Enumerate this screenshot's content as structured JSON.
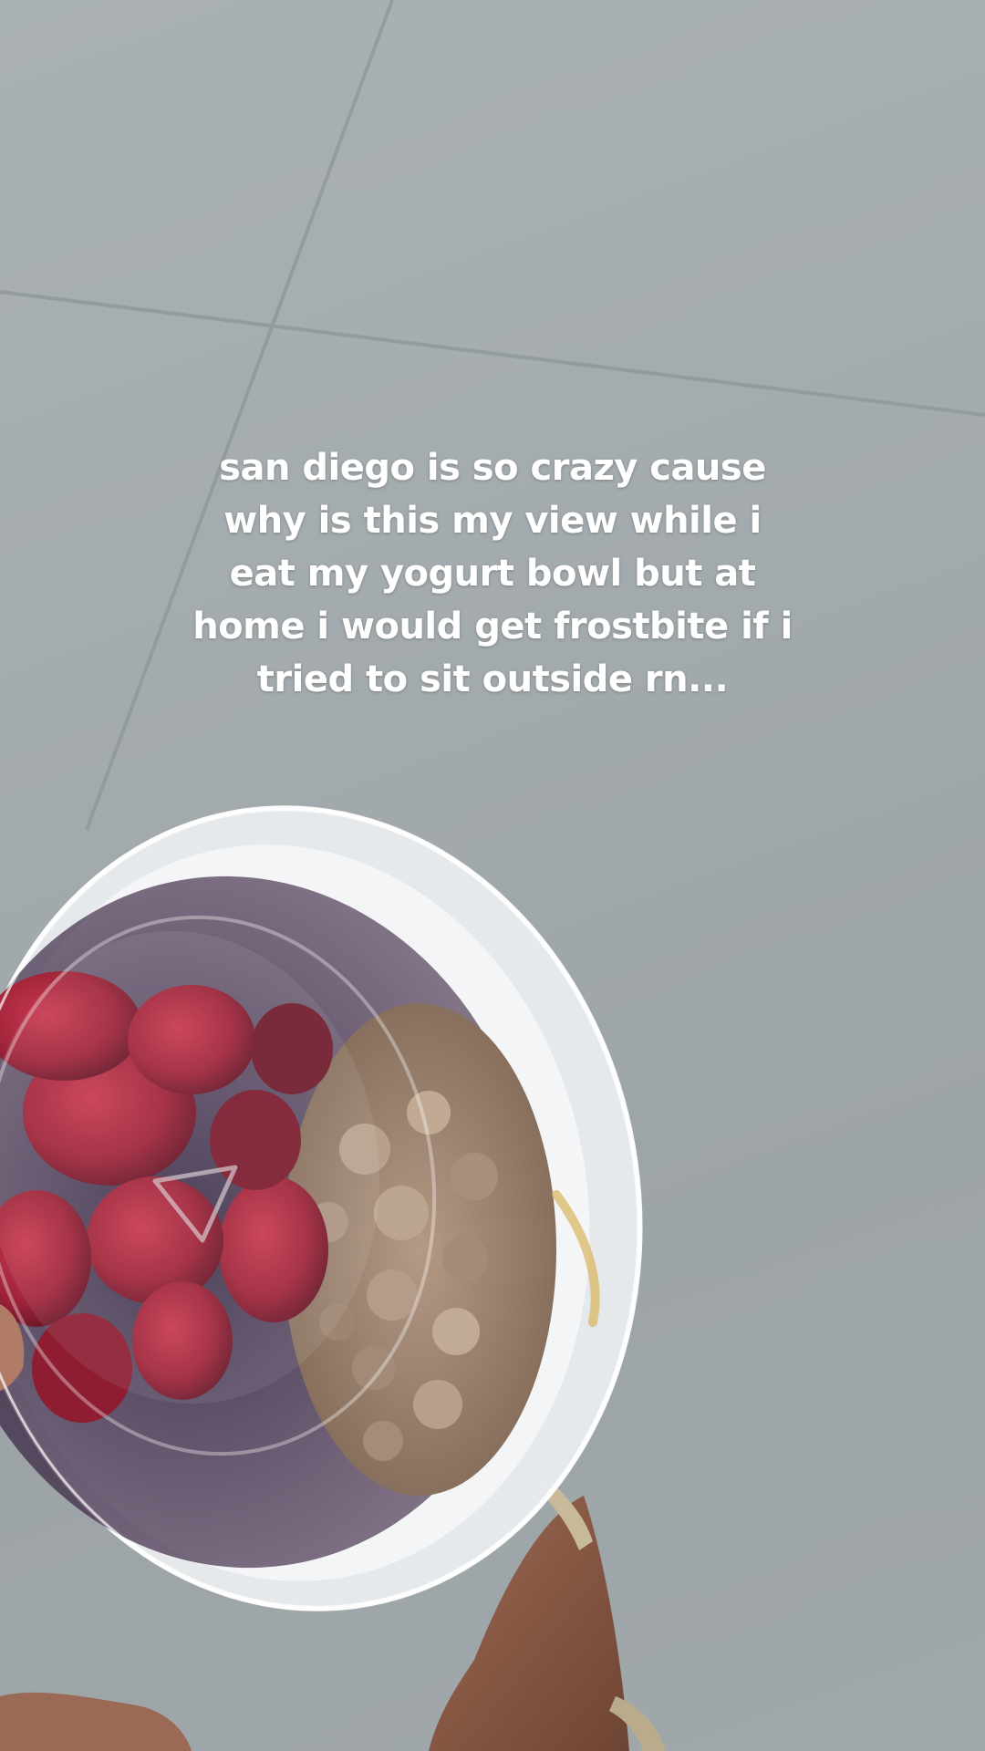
{
  "caption": {
    "lines": [
      "san diego is so crazy cause",
      "why is this my view while i",
      "eat my yogurt bowl but at",
      "home i would get frostbite if i",
      "tried to sit outside rn..."
    ]
  },
  "photo": {
    "subject": "yogurt-bowl-with-berries-and-granola",
    "background": "concrete-pavement",
    "colors": {
      "pavement": "#a7aeb1",
      "cup": "#eef0f4",
      "berries": "#a3243a",
      "granola": "#a88f7b",
      "skin": "#8a5a44"
    }
  }
}
